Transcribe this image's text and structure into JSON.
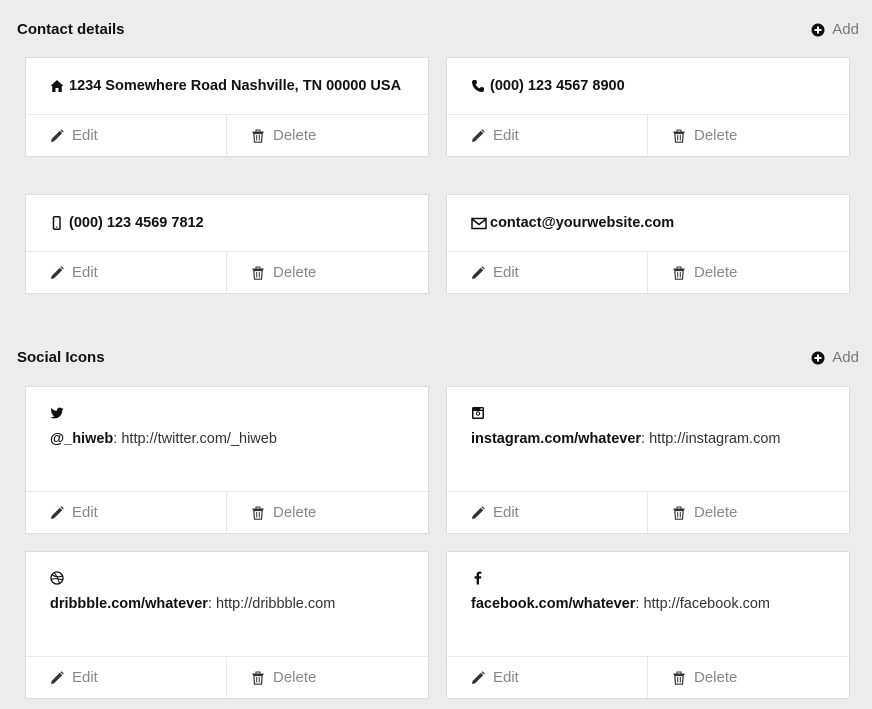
{
  "contact_section": {
    "title": "Contact details",
    "add_label": "Add",
    "items": [
      {
        "icon": "home-icon",
        "text": "1234 Somewhere Road Nashville, TN 00000 USA"
      },
      {
        "icon": "phone-icon",
        "text": "(000) 123 4567 8900"
      },
      {
        "icon": "mobile-icon",
        "text": "(000) 123 4569 7812"
      },
      {
        "icon": "envelope-icon",
        "text": "contact@yourwebsite.com"
      }
    ]
  },
  "social_section": {
    "title": "Social Icons",
    "add_label": "Add",
    "items": [
      {
        "icon": "twitter-icon",
        "handle": "@_hiweb",
        "separator": ": ",
        "url": "http://twitter.com/_hiweb"
      },
      {
        "icon": "instagram-icon",
        "handle": "instagram.com/whatever",
        "separator": ": ",
        "url": "http://instagram.com"
      },
      {
        "icon": "dribbble-icon",
        "handle": "dribbble.com/whatever",
        "separator": ": ",
        "url": "http://dribbble.com"
      },
      {
        "icon": "facebook-icon",
        "handle": "facebook.com/whatever",
        "separator": ": ",
        "url": "http://facebook.com"
      }
    ]
  },
  "actions": {
    "edit_label": "Edit",
    "delete_label": "Delete"
  }
}
